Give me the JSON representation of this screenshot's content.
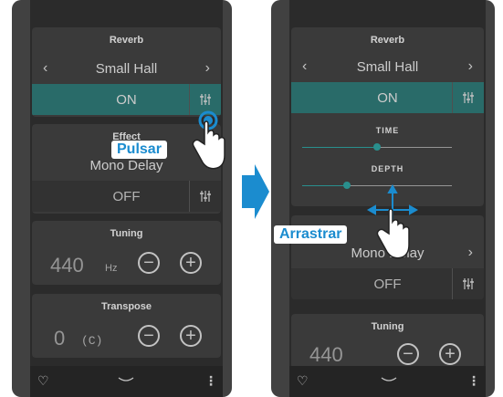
{
  "left": {
    "reverb": {
      "title": "Reverb",
      "type": "Small Hall",
      "state": "ON"
    },
    "effect": {
      "title": "Effect",
      "type": "Mono Delay",
      "state": "OFF"
    },
    "tuning": {
      "title": "Tuning",
      "value": "440",
      "unit": "Hz"
    },
    "transpose": {
      "title": "Transpose",
      "value": "0",
      "key": "(C)"
    },
    "callout": "Pulsar"
  },
  "right": {
    "reverb": {
      "title": "Reverb",
      "type": "Small Hall",
      "state": "ON"
    },
    "time_label": "TIME",
    "depth_label": "DEPTH",
    "time_level": 0.5,
    "depth_level": 0.3,
    "effect": {
      "type": "Mono Delay",
      "state": "OFF"
    },
    "tuning": {
      "title": "Tuning",
      "value": "440"
    },
    "callout": "Arrastrar"
  },
  "icons": {
    "heart": "heart-icon",
    "chevron_down": "chevron-down-icon",
    "more": "more-icon"
  },
  "colors": {
    "on_bg": "#2f7a78",
    "accent": "#2fa3a1",
    "arrow": "#1b8ccf",
    "callout_text": "#1b8ccf"
  }
}
